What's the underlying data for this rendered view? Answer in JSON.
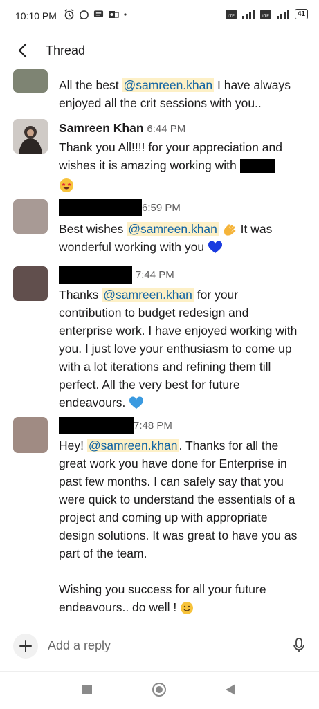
{
  "status": {
    "time": "10:10 PM",
    "net_badge": "4G",
    "battery": "41"
  },
  "header": {
    "title": "Thread"
  },
  "messages": [
    {
      "text_before": "All the best ",
      "mention": "@samreen.khan",
      "text_after": " I have always enjoyed all the crit sessions with you.."
    },
    {
      "name": "Samreen Khan",
      "time": "6:44 PM",
      "text": "Thank you All!!!! for your appreciation and wishes it is amazing working with"
    },
    {
      "time": "6:59 PM",
      "text_before": "Best wishes ",
      "mention": "@samreen.khan",
      "text_after": " It was wonderful working with you"
    },
    {
      "time": "7:44 PM",
      "text_before": "Thanks ",
      "mention": "@samreen.khan",
      "text_after": " for your contribution to budget redesign and enterprise work. I have enjoyed working with you. I just love your enthusiasm to come up with a lot iterations and refining them till perfect. All the very best for future endeavours."
    },
    {
      "time": "7:48 PM",
      "text_before": "Hey! ",
      "mention": "@samreen.khan",
      "text_after": ". Thanks for all the great work you have done for Enterprise in past few months. I can safely say that you were quick to understand the essentials of a project and coming up with appropriate design solutions. It was great to have you as part of the team.",
      "text_para2": "Wishing you success for all your future endeavours.. do well !"
    }
  ],
  "composer": {
    "placeholder": "Add a reply"
  },
  "icons": {
    "back": "chevron-left-icon",
    "add": "plus-icon",
    "mic": "microphone-icon"
  }
}
